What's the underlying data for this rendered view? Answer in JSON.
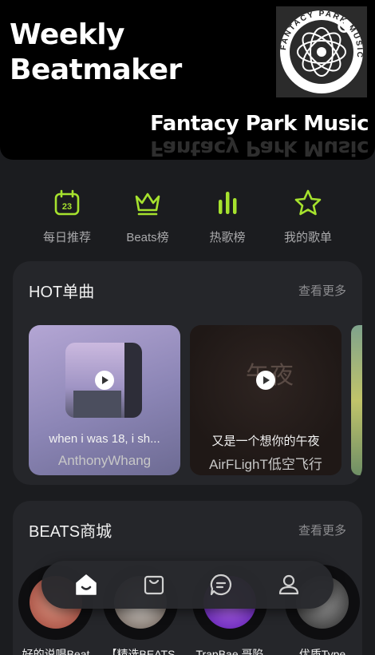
{
  "banner": {
    "title_line1": "Weekly",
    "title_line2": "Beatmaker",
    "brand": "Fantacy Park Music",
    "logo_text": "FANTACY PARK MUSIC"
  },
  "quick_actions": [
    {
      "label": "每日推荐",
      "icon": "calendar-icon",
      "badge": "23"
    },
    {
      "label": "Beats榜",
      "icon": "crown-icon"
    },
    {
      "label": "热歌榜",
      "icon": "bars-icon"
    },
    {
      "label": "我的歌单",
      "icon": "star-icon"
    }
  ],
  "hot": {
    "title": "HOT单曲",
    "more": "查看更多",
    "songs": [
      {
        "title": "when i was 18, i sh...",
        "artist": "AnthonyWhang"
      },
      {
        "title": "又是一个想你的午夜",
        "artist": "AirFLighT低空飞行",
        "cover_text": "午夜"
      }
    ]
  },
  "beats": {
    "title": "BEATS商城",
    "more": "查看更多",
    "items": [
      {
        "name": "好的说唱Beat"
      },
      {
        "name": "【精选BEATS"
      },
      {
        "name": "TrapBae 哥陷"
      },
      {
        "name": "优质Type"
      }
    ]
  },
  "nav": [
    "home-icon",
    "bag-icon",
    "chat-icon",
    "profile-icon"
  ],
  "colors": {
    "accent": "#a6e22e",
    "background": "#1b1c1f",
    "card": "#25262a"
  }
}
